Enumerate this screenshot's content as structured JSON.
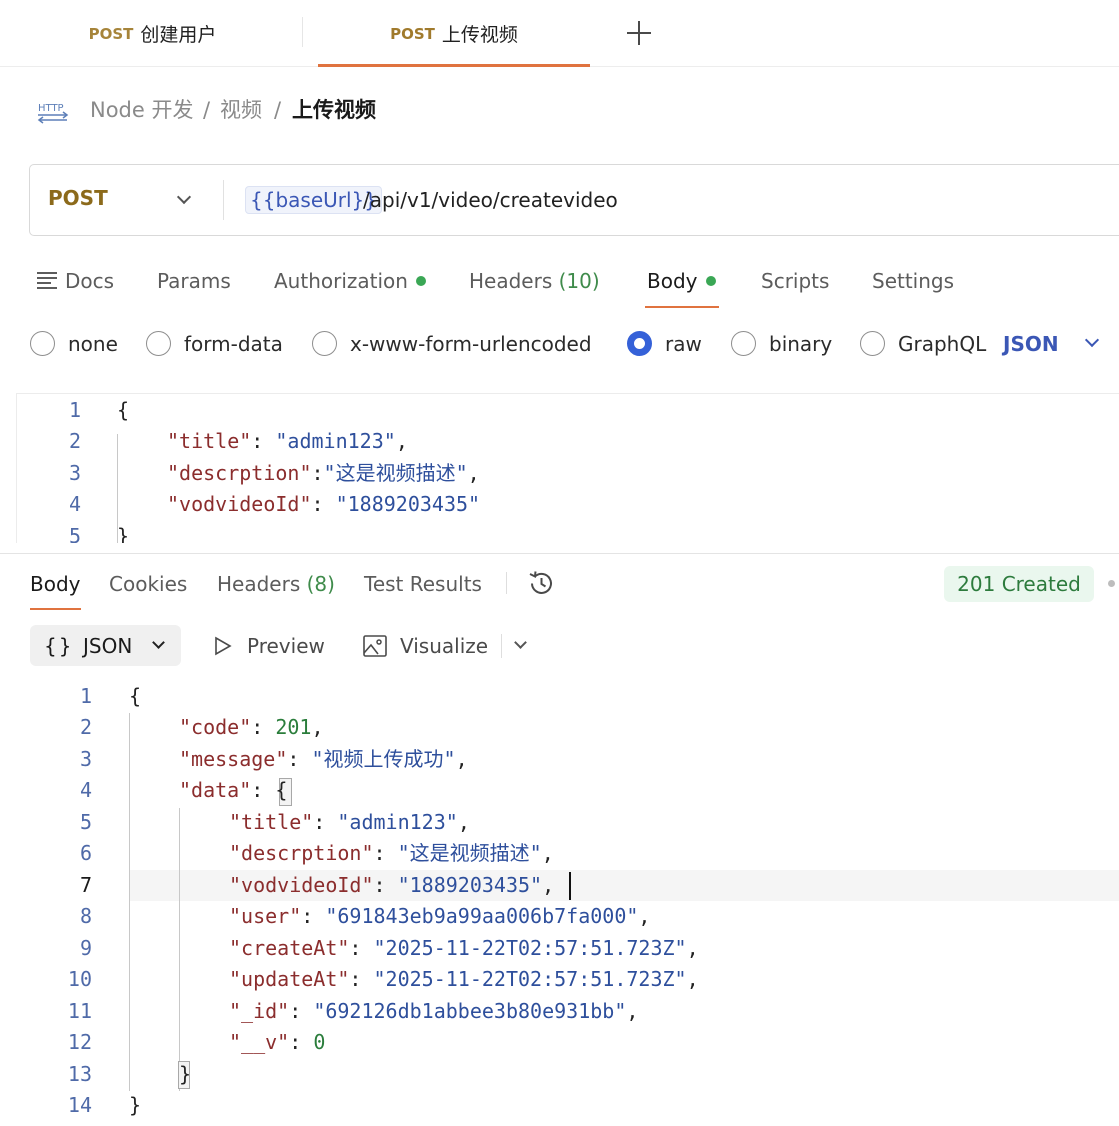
{
  "tabs": [
    {
      "method": "POST",
      "label": "创建用户"
    },
    {
      "method": "POST",
      "label": "上传视频"
    }
  ],
  "breadcrumb": {
    "icon_label": "HTTP",
    "items": [
      "Node 开发",
      "视频",
      "上传视频"
    ],
    "separator": "/"
  },
  "request": {
    "method": "POST",
    "base_url_var": "{{baseUrl}}",
    "path": "/api/v1/video/createvideo"
  },
  "request_tabs": [
    {
      "label": "Docs"
    },
    {
      "label": "Params"
    },
    {
      "label": "Authorization"
    },
    {
      "label": "Headers",
      "count": "(10)"
    },
    {
      "label": "Body"
    },
    {
      "label": "Scripts"
    },
    {
      "label": "Settings"
    }
  ],
  "body_types": [
    "none",
    "form-data",
    "x-www-form-urlencoded",
    "raw",
    "binary",
    "GraphQL"
  ],
  "selected_body_type": "raw",
  "raw_format": "JSON",
  "request_body": [
    {
      "n": "1",
      "t": "{"
    },
    {
      "n": "2",
      "key": "\"title\"",
      "sep": ": ",
      "val": "\"admin123\"",
      "end": ","
    },
    {
      "n": "3",
      "key": "\"descrption\"",
      "sep": ":",
      "val": "\"这是视频描述\"",
      "end": ","
    },
    {
      "n": "4",
      "key": "\"vodvideoId\"",
      "sep": ": ",
      "val": "\"1889203435\"",
      "end": ""
    },
    {
      "n": "5",
      "t": "}"
    }
  ],
  "response_tabs": [
    {
      "label": "Body"
    },
    {
      "label": "Cookies"
    },
    {
      "label": "Headers",
      "count": "(8)"
    },
    {
      "label": "Test Results"
    }
  ],
  "status": "201 Created",
  "response_format": {
    "label": "JSON",
    "icon": "{}"
  },
  "response_views": [
    "Preview",
    "Visualize"
  ],
  "response_body": [
    {
      "n": "1",
      "text": "{"
    },
    {
      "n": "2",
      "text": "\"code\": 201,"
    },
    {
      "n": "3",
      "text": "\"message\": \"视频上传成功\","
    },
    {
      "n": "4",
      "text": "\"data\": {"
    },
    {
      "n": "5",
      "text": "\"title\": \"admin123\","
    },
    {
      "n": "6",
      "text": "\"descrption\": \"这是视频描述\","
    },
    {
      "n": "7",
      "text": "\"vodvideoId\": \"1889203435\","
    },
    {
      "n": "8",
      "text": "\"user\": \"691843eb9a99aa006b7fa000\","
    },
    {
      "n": "9",
      "text": "\"createAt\": \"2025-11-22T02:57:51.723Z\","
    },
    {
      "n": "10",
      "text": "\"updateAt\": \"2025-11-22T02:57:51.723Z\","
    },
    {
      "n": "11",
      "text": "\"_id\": \"692126db1abbee3b80e931bb\","
    },
    {
      "n": "12",
      "text": "\"__v\": 0"
    },
    {
      "n": "13",
      "text": "}"
    },
    {
      "n": "14",
      "text": "}"
    }
  ],
  "colors": {
    "accent": "#e0733f",
    "method": "#8c6a1b",
    "variable": "#3b57b5",
    "success": "#2d7b3d"
  }
}
